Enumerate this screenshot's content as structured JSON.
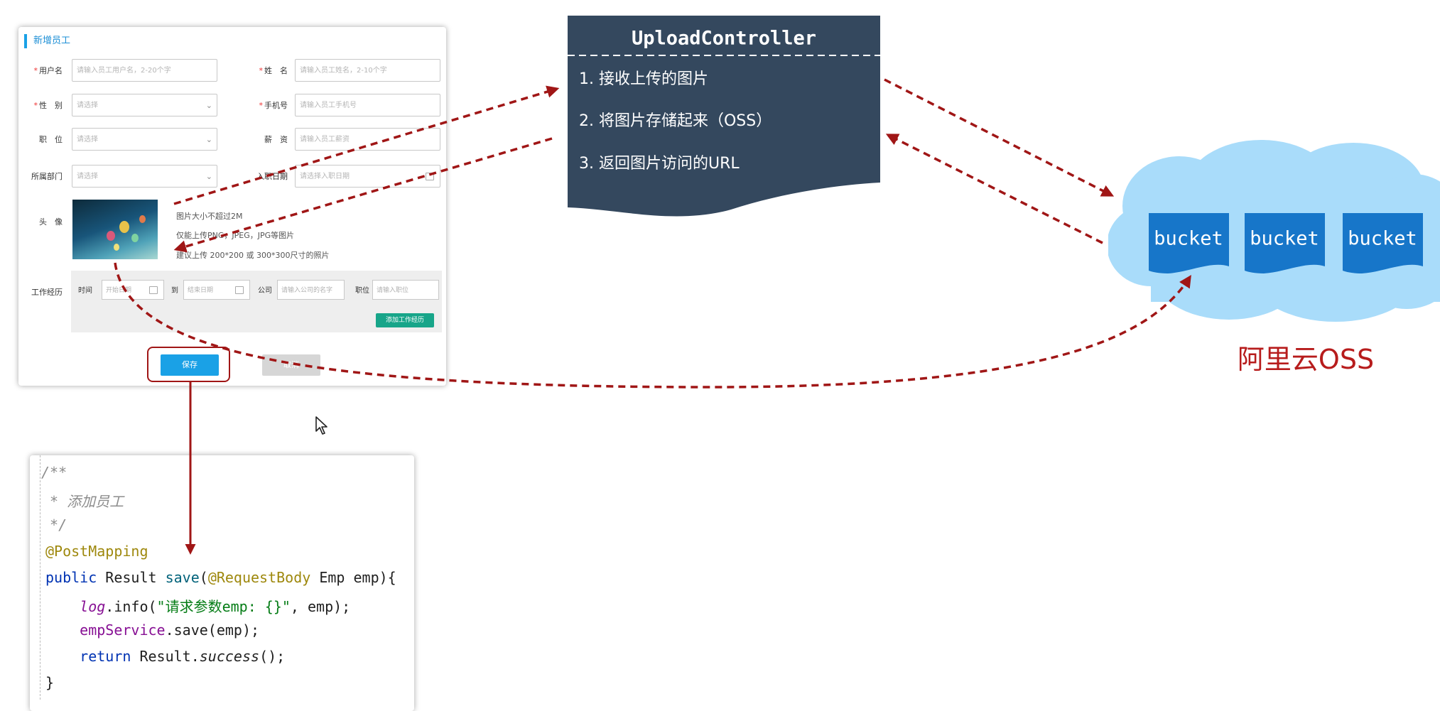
{
  "form": {
    "title": "新增员工",
    "fields": {
      "username": {
        "label": "用户名",
        "placeholder": "请输入员工用户名，2-20个字"
      },
      "name": {
        "label": "姓　名",
        "placeholder": "请输入员工姓名，2-10个字"
      },
      "gender": {
        "label": "性　别",
        "placeholder": "请选择"
      },
      "phone": {
        "label": "手机号",
        "placeholder": "请输入员工手机号"
      },
      "job": {
        "label": "职　位",
        "placeholder": "请选择"
      },
      "salary": {
        "label": "薪　资",
        "placeholder": "请输入员工薪资"
      },
      "dept": {
        "label": "所属部门",
        "placeholder": "请选择"
      },
      "entry_date": {
        "label": "入职日期",
        "placeholder": "请选择入职日期"
      }
    },
    "avatar": {
      "label": "头　像",
      "hints": [
        "图片大小不超过2M",
        "仅能上传PNG，JPEG，JPG等图片",
        "建议上传 200*200 或 300*300尺寸的照片"
      ]
    },
    "work": {
      "label": "工作经历",
      "time_label": "时间",
      "start_placeholder": "开始日期",
      "to_label": "到",
      "end_placeholder": "结束日期",
      "company_label": "公司",
      "company_placeholder": "请输入公司的名字",
      "position_label": "职位",
      "position_placeholder": "请输入职位",
      "add_button": "添加工作经历"
    },
    "save_button": "保存",
    "cancel_button": "取消"
  },
  "upload_controller": {
    "title": "UploadController",
    "steps": [
      "1. 接收上传的图片",
      "2. 将图片存储起来（OSS）",
      "3. 返回图片访问的URL"
    ]
  },
  "oss": {
    "label": "阿里云OSS",
    "buckets": [
      "bucket",
      "bucket",
      "bucket"
    ]
  },
  "code": {
    "comment_open": "/**",
    "comment_body": " * 添加员工",
    "comment_close": " */",
    "annotation": "@PostMapping",
    "sig_public": "public ",
    "sig_result": "Result ",
    "sig_method": "save",
    "sig_open": "(",
    "sig_param_annot": "@RequestBody",
    "sig_rest": " Emp emp){",
    "log_indent": "    ",
    "log_field": "log",
    "log_call": ".info(",
    "log_string": "\"请求参数emp: {}\"",
    "log_end": ", emp);",
    "svc_field": "empService",
    "svc_call": ".save(emp);",
    "ret_kw": "return ",
    "ret_obj": "Result.",
    "ret_method": "success",
    "ret_end": "();",
    "close_brace": "}"
  },
  "colors": {
    "arrow": "#a01616",
    "controller_bg": "#34485e",
    "bucket": "#1776c9",
    "cloud": "#a9dcfa",
    "save_button": "#1aa1e6",
    "add_button": "#17a589"
  }
}
